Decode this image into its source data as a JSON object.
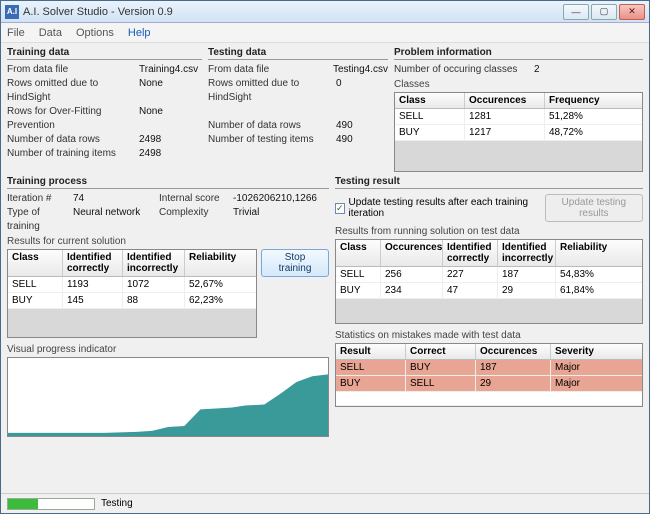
{
  "window": {
    "title": "A.I. Solver Studio - Version 0.9"
  },
  "menu": {
    "file": "File",
    "data": "Data",
    "options": "Options",
    "help": "Help"
  },
  "training_data": {
    "title": "Training data",
    "file_label": "From data file",
    "file_value": "Training4.csv",
    "hindsight_label": "Rows omitted due to HindSight",
    "hindsight_value": "None",
    "overfit_label": "Rows for Over-Fitting Prevention",
    "overfit_value": "None",
    "rows_label": "Number of data rows",
    "rows_value": "2498",
    "items_label": "Number of training items",
    "items_value": "2498"
  },
  "testing_data": {
    "title": "Testing data",
    "file_label": "From data file",
    "file_value": "Testing4.csv",
    "hindsight_label": "Rows omitted due to HindSight",
    "hindsight_value": "0",
    "rows_label": "Number of data rows",
    "rows_value": "490",
    "items_label": "Number of testing items",
    "items_value": "490"
  },
  "problem": {
    "title": "Problem information",
    "classes_label": "Number of occuring classes",
    "classes_value": "2",
    "classes_sub": "Classes",
    "hdr": {
      "class": "Class",
      "occ": "Occurences",
      "freq": "Frequency"
    },
    "rows": [
      {
        "class": "SELL",
        "occ": "1281",
        "freq": "51,28%"
      },
      {
        "class": "BUY",
        "occ": "1217",
        "freq": "48,72%"
      }
    ]
  },
  "process": {
    "title": "Training process",
    "iter_label": "Iteration #",
    "iter_value": "74",
    "score_label": "Internal score",
    "score_value": "-1026206210,1266",
    "type_label": "Type of training",
    "type_value": "Neural network",
    "complexity_label": "Complexity",
    "complexity_value": "Trivial",
    "results_label": "Results for current solution",
    "hdr": {
      "class": "Class",
      "corr": "Identified correctly",
      "incorr": "Identified incorrectly",
      "rel": "Reliability"
    },
    "rows": [
      {
        "class": "SELL",
        "corr": "1193",
        "incorr": "1072",
        "rel": "52,67%"
      },
      {
        "class": "BUY",
        "corr": "145",
        "incorr": "88",
        "rel": "62,23%"
      }
    ],
    "stop_btn": "Stop training",
    "visual_label": "Visual progress indicator"
  },
  "testing_result": {
    "title": "Testing result",
    "chk_label": "Update testing results after each training iteration",
    "update_btn": "Update testing results",
    "running_label": "Results from running solution on test data",
    "hdr": {
      "class": "Class",
      "occ": "Occurences",
      "corr": "Identified correctly",
      "incorr": "Identified incorrectly",
      "rel": "Reliability"
    },
    "rows": [
      {
        "class": "SELL",
        "occ": "256",
        "corr": "227",
        "incorr": "187",
        "rel": "54,83%"
      },
      {
        "class": "BUY",
        "occ": "234",
        "corr": "47",
        "incorr": "29",
        "rel": "61,84%"
      }
    ],
    "stats_label": "Statistics on mistakes made with test data",
    "shdr": {
      "result": "Result",
      "correct": "Correct",
      "occ": "Occurences",
      "sev": "Severity"
    },
    "srows": [
      {
        "result": "SELL",
        "correct": "BUY",
        "occ": "187",
        "sev": "Major"
      },
      {
        "result": "BUY",
        "correct": "SELL",
        "occ": "29",
        "sev": "Major"
      }
    ]
  },
  "status": {
    "text": "Testing",
    "progress_pct": 35
  },
  "chart_data": {
    "type": "line",
    "title": "Visual progress indicator",
    "xlabel": "",
    "ylabel": "",
    "x": [
      0,
      10,
      20,
      30,
      40,
      45,
      50,
      55,
      60,
      65,
      70,
      74,
      80,
      85,
      90,
      95,
      100
    ],
    "values": [
      5,
      5,
      5,
      5,
      6,
      8,
      12,
      14,
      35,
      36,
      38,
      40,
      42,
      55,
      70,
      78,
      80
    ],
    "ylim": [
      0,
      100
    ]
  }
}
